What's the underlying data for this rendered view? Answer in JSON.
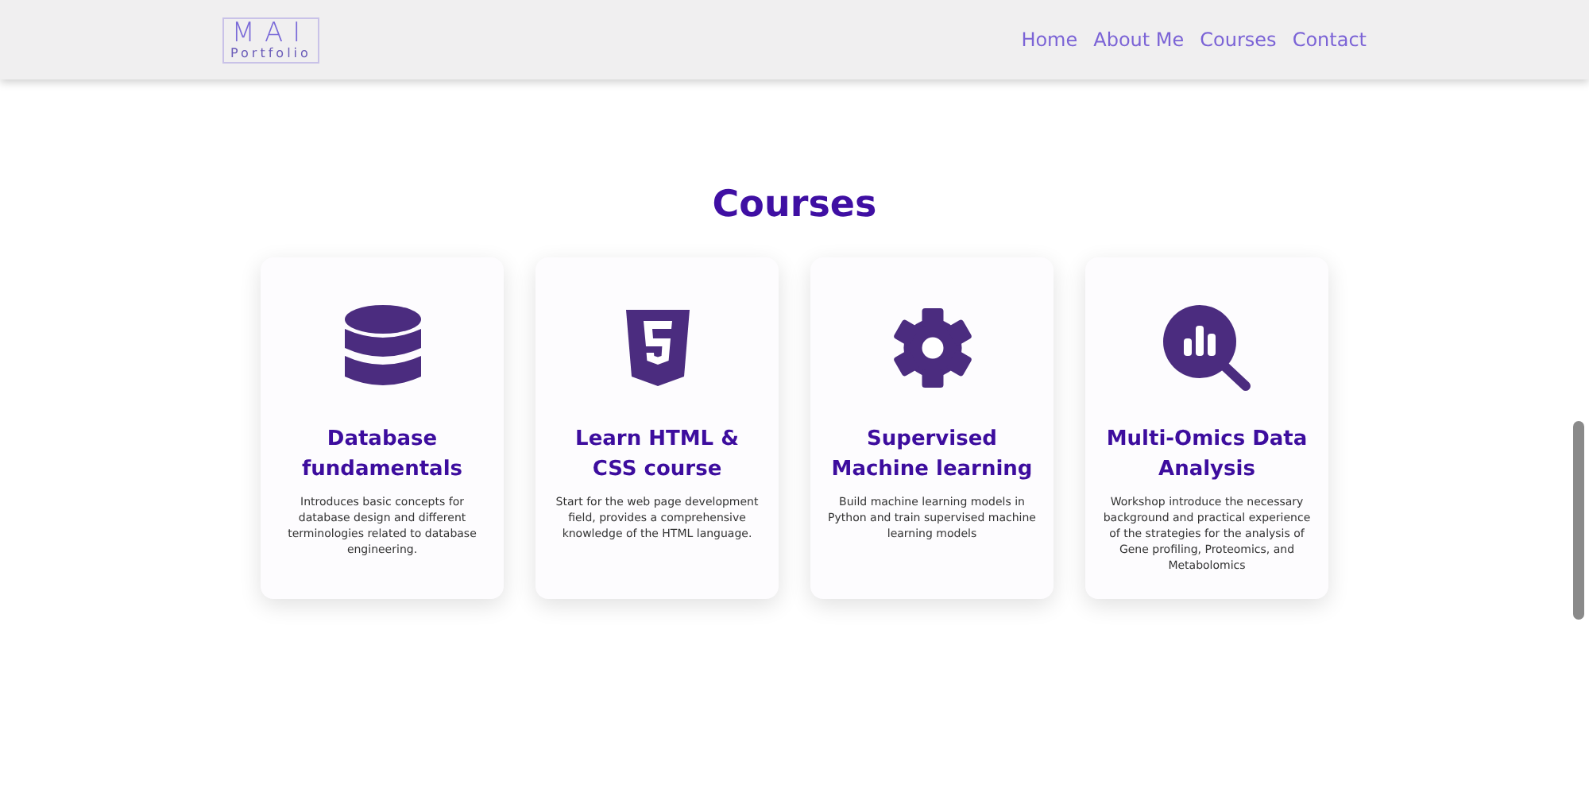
{
  "logo": {
    "mark": "MAI",
    "subtitle": "Portfolio"
  },
  "nav": [
    {
      "label": "Home"
    },
    {
      "label": "About Me"
    },
    {
      "label": "Courses"
    },
    {
      "label": "Contact"
    }
  ],
  "section_title": "Courses",
  "courses": [
    {
      "kind": "database",
      "title": "Database fundamentals",
      "description": "Introduces basic concepts for database design and different terminologies related to database engineering."
    },
    {
      "kind": "html",
      "title": "Learn HTML & CSS course",
      "description": "Start for the web page development field, provides a comprehensive knowledge of the HTML language."
    },
    {
      "kind": "gear",
      "title": "Supervised Machine learning",
      "description": "Build machine learning models in Python and train supervised machine learning models"
    },
    {
      "kind": "analysis",
      "title": "Multi-Omics Data Analysis",
      "description": "Workshop introduce the necessary background and practical experience of the strategies for the analysis of Gene profiling, Proteomics, and Metabolomics"
    }
  ]
}
